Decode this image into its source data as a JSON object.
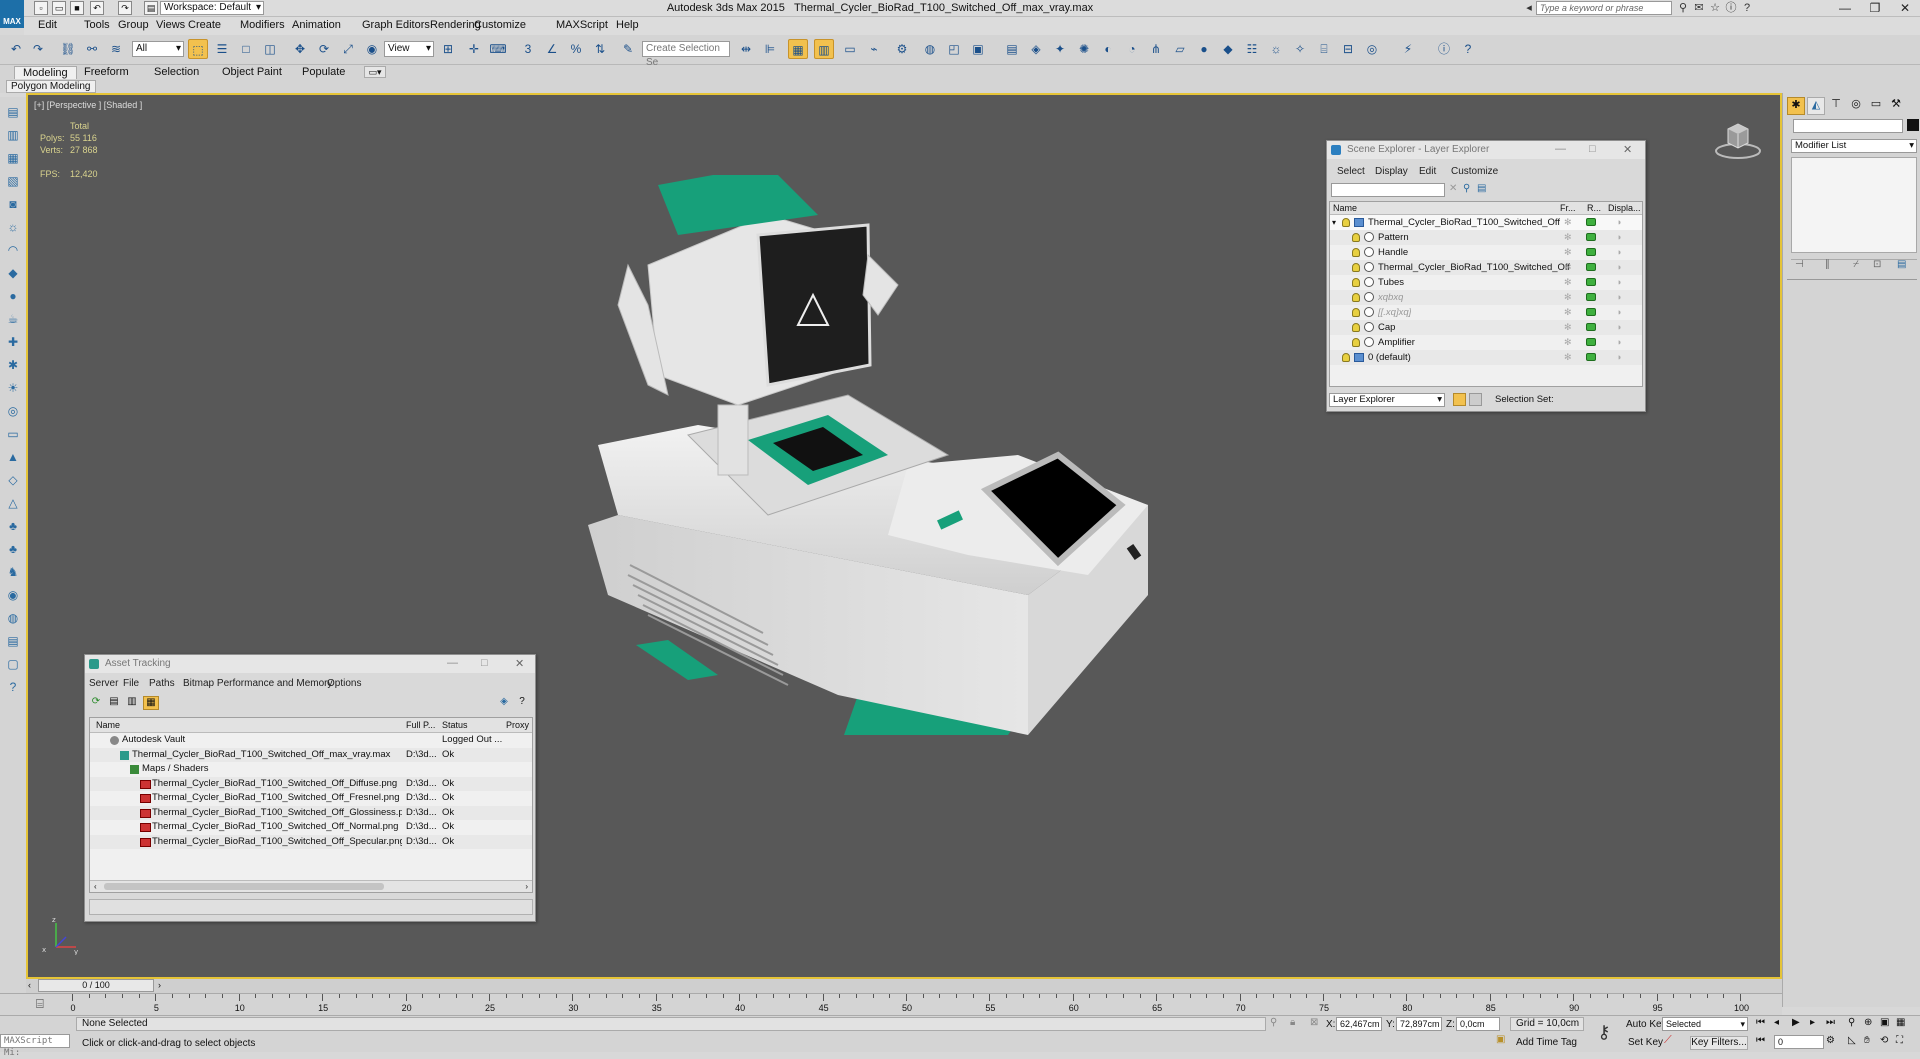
{
  "titlebar": {
    "workspace": "Workspace: Default",
    "app_title": "Autodesk 3ds Max  2015",
    "file_name": "Thermal_Cycler_BioRad_T100_Switched_Off_max_vray.max",
    "search_placeholder": "Type a keyword or phrase"
  },
  "menu": [
    "Edit",
    "Tools",
    "Group",
    "Views",
    "Create",
    "Modifiers",
    "Animation",
    "Graph Editors",
    "Rendering",
    "Customize",
    "MAXScript",
    "Help"
  ],
  "toolbar": {
    "selection_filter": "All",
    "ref_coord": "View",
    "named_selection": "Create Selection Se"
  },
  "ribbon": {
    "tabs": [
      "Modeling",
      "Freeform",
      "Selection",
      "Object Paint",
      "Populate"
    ],
    "sub_tab": "Polygon Modeling"
  },
  "viewport": {
    "label": "[+] [Perspective ] [Shaded ]",
    "stats_header": "Total",
    "polys_label": "Polys:",
    "polys_value": "55 116",
    "verts_label": "Verts:",
    "verts_value": "27 868",
    "fps_label": "FPS:",
    "fps_value": "12,420"
  },
  "scene_explorer": {
    "title": "Scene Explorer - Layer Explorer",
    "menu": [
      "Select",
      "Display",
      "Edit",
      "Customize"
    ],
    "columns": [
      "Name",
      "Fr...",
      "R...",
      "Displa..."
    ],
    "rows": [
      {
        "name": "Thermal_Cycler_BioRad_T100_Switched_Off",
        "level": 0
      },
      {
        "name": "Pattern",
        "level": 1
      },
      {
        "name": "Handle",
        "level": 1
      },
      {
        "name": "Thermal_Cycler_BioRad_T100_Switched_Off",
        "level": 1
      },
      {
        "name": "Tubes",
        "level": 1
      },
      {
        "name": "xqbxq",
        "level": 1
      },
      {
        "name": "[[.xq]xq]",
        "level": 1
      },
      {
        "name": "Cap",
        "level": 1
      },
      {
        "name": "Amplifier",
        "level": 1
      },
      {
        "name": "0 (default)",
        "level": 0
      }
    ],
    "footer_mode": "Layer Explorer",
    "selection_set_label": "Selection Set:"
  },
  "asset_tracking": {
    "title": "Asset Tracking",
    "menu": [
      "Server",
      "File",
      "Paths",
      "Bitmap Performance and Memory",
      "Options"
    ],
    "columns": [
      "Name",
      "Full P...",
      "Status",
      "Proxy F"
    ],
    "rows": [
      {
        "name": "Autodesk Vault",
        "path": "",
        "status": "Logged Out ...",
        "level": 0
      },
      {
        "name": "Thermal_Cycler_BioRad_T100_Switched_Off_max_vray.max",
        "path": "D:\\3d...",
        "status": "Ok",
        "level": 1
      },
      {
        "name": "Maps / Shaders",
        "path": "",
        "status": "",
        "level": 2
      },
      {
        "name": "Thermal_Cycler_BioRad_T100_Switched_Off_Diffuse.png",
        "path": "D:\\3d...",
        "status": "Ok",
        "level": 3
      },
      {
        "name": "Thermal_Cycler_BioRad_T100_Switched_Off_Fresnel.png",
        "path": "D:\\3d...",
        "status": "Ok",
        "level": 3
      },
      {
        "name": "Thermal_Cycler_BioRad_T100_Switched_Off_Glossiness.png",
        "path": "D:\\3d...",
        "status": "Ok",
        "level": 3
      },
      {
        "name": "Thermal_Cycler_BioRad_T100_Switched_Off_Normal.png",
        "path": "D:\\3d...",
        "status": "Ok",
        "level": 3
      },
      {
        "name": "Thermal_Cycler_BioRad_T100_Switched_Off_Specular.png",
        "path": "D:\\3d...",
        "status": "Ok",
        "level": 3
      }
    ]
  },
  "command_panel": {
    "modifier_list": "Modifier List"
  },
  "timeline": {
    "frame": "0 / 100",
    "ticks": [
      "0",
      "5",
      "10",
      "15",
      "20",
      "25",
      "30",
      "35",
      "40",
      "45",
      "50",
      "55",
      "60",
      "65",
      "70",
      "75",
      "80",
      "85",
      "90",
      "95",
      "100"
    ]
  },
  "status": {
    "maxscript": "MAXScript Mi:",
    "selection": "None Selected",
    "prompt": "Click or click-and-drag to select objects",
    "x_label": "X:",
    "x_value": "62,467cm",
    "y_label": "Y:",
    "y_value": "72,897cm",
    "z_label": "Z:",
    "z_value": "0,0cm",
    "grid": "Grid = 10,0cm",
    "add_time_tag": "Add Time Tag",
    "auto_key": "Auto Key",
    "set_key": "Set Key",
    "key_mode": "Selected",
    "key_filters": "Key Filters...",
    "frame_value": "0"
  }
}
